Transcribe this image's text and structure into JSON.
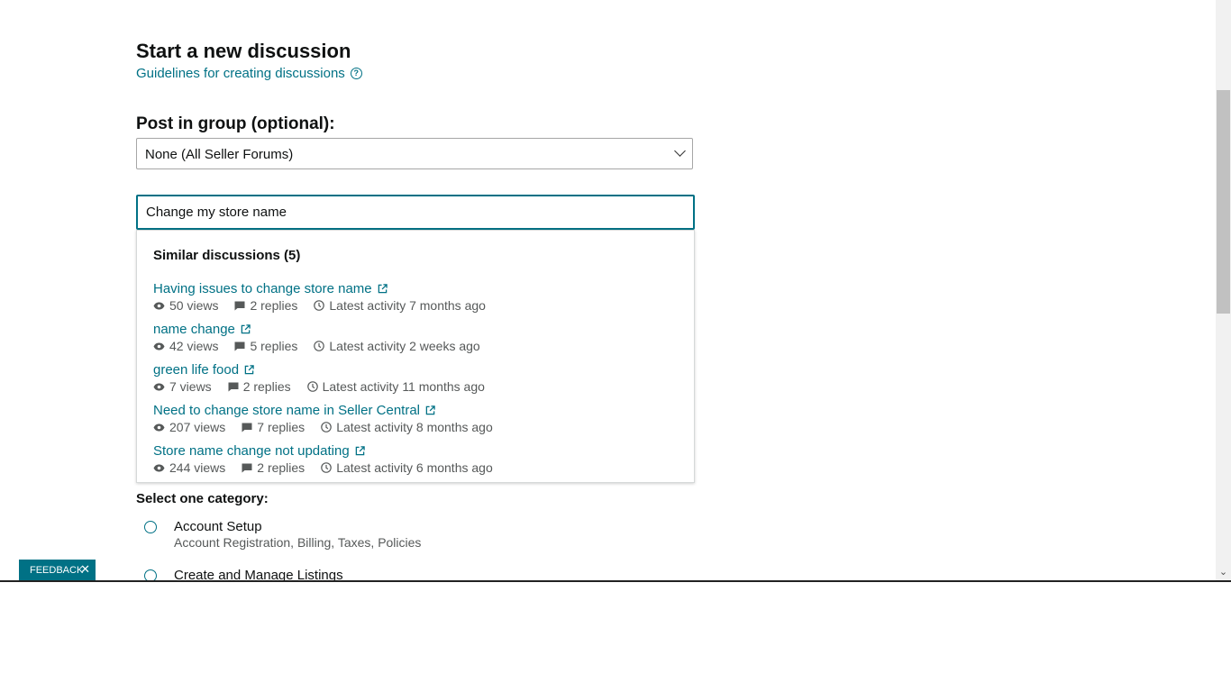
{
  "page": {
    "title": "Start a new discussion",
    "guidelines_link": "Guidelines for creating discussions"
  },
  "group": {
    "label": "Post in group (optional):",
    "selected": "None (All Seller Forums)"
  },
  "discussion_input": {
    "value": "Change my store name"
  },
  "similar": {
    "header": "Similar discussions (5)",
    "items": [
      {
        "title": "Having issues to change store name",
        "views": "50 views",
        "replies": "2 replies",
        "activity": "Latest activity 7 months ago"
      },
      {
        "title": "name change",
        "views": "42 views",
        "replies": "5 replies",
        "activity": "Latest activity 2 weeks ago"
      },
      {
        "title": "green life food",
        "views": "7 views",
        "replies": "2 replies",
        "activity": "Latest activity 11 months ago"
      },
      {
        "title": "Need to change store name in Seller Central",
        "views": "207 views",
        "replies": "7 replies",
        "activity": "Latest activity 8 months ago"
      },
      {
        "title": "Store name change not updating",
        "views": "244 views",
        "replies": "2 replies",
        "activity": "Latest activity 6 months ago"
      }
    ]
  },
  "category": {
    "label": "Select one category:",
    "options": [
      {
        "title": "Account Setup",
        "description": "Account Registration, Billing, Taxes, Policies"
      },
      {
        "title": "Create and Manage Listings",
        "description": ""
      }
    ]
  },
  "feedback": {
    "label": "FEEDBACK"
  },
  "colors": {
    "link": "#007185",
    "text": "#0f1111",
    "muted": "#565959"
  }
}
